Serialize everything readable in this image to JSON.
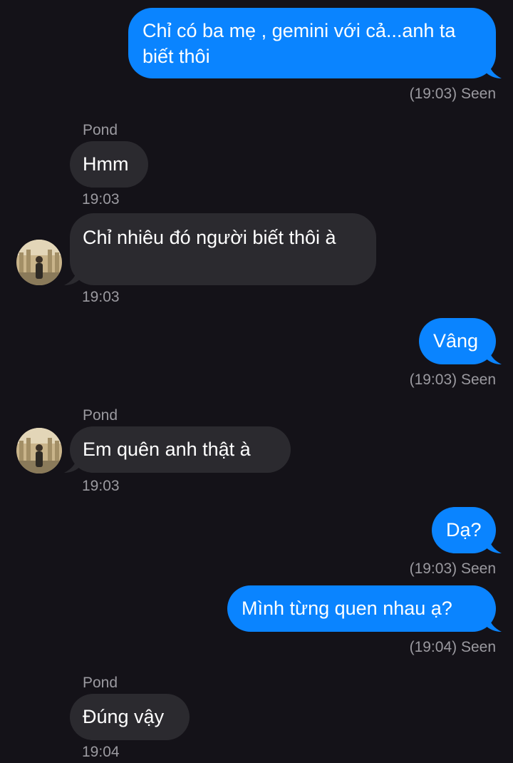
{
  "messages": {
    "m1": {
      "text": "Chỉ có ba mẹ , gemini với cả...anh ta biết thôi",
      "meta": "(19:03) Seen"
    },
    "m2": {
      "sender": "Pond",
      "text": "Hmm",
      "time": "19:03"
    },
    "m3": {
      "text": "Chỉ nhiêu đó người biết thôi à",
      "time": "19:03"
    },
    "m4": {
      "text": "Vâng",
      "meta": "(19:03) Seen"
    },
    "m5": {
      "sender": "Pond",
      "text": "Em quên anh thật à",
      "time": "19:03"
    },
    "m6": {
      "text": "Dạ?",
      "meta": "(19:03) Seen"
    },
    "m7": {
      "text": "Mình từng quen nhau ạ?",
      "meta": "(19:04) Seen"
    },
    "m8": {
      "sender": "Pond",
      "text": "Đúng vậy",
      "time": "19:04"
    }
  },
  "colors": {
    "background": "#141218",
    "outgoing": "#0a84ff",
    "incoming": "#2b2a2f",
    "meta": "#9b9aa0"
  },
  "icons": {
    "avatar": "avatar-photo-icon"
  }
}
